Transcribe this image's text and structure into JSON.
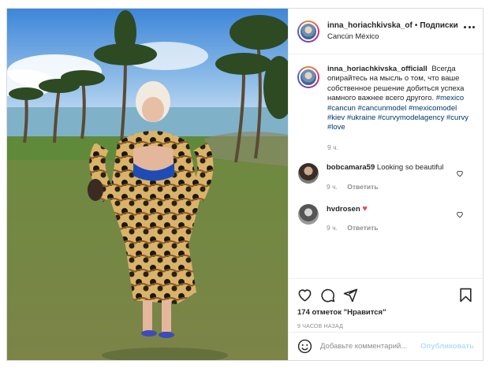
{
  "post": {
    "header": {
      "username": "inna_horiachkivska_of",
      "separator": "•",
      "follow_label": "Подписки",
      "location": "Cancún México",
      "more_icon": "more-horizontal-icon"
    },
    "caption": {
      "username": "inna_horiachkivska_officiall",
      "text": "Всегда опирайтесь на мысль о том, что ваше собственное решение добиться успеха намного важнее всего другого.",
      "hashtags": "#mexico #cancun #cancunmodel #mexicomodel #kiev #ukraine #curvymodelagency #curvy #love",
      "time": "9 ч."
    },
    "comments": [
      {
        "username": "bobcamara59",
        "text": "Looking so beautiful",
        "time": "9 ч.",
        "reply": "Ответить"
      },
      {
        "username": "hvdrosen",
        "text": "♥",
        "time": "9 ч.",
        "reply": "Ответить"
      }
    ],
    "actions": {
      "icons": [
        "heart-icon",
        "comment-icon",
        "share-icon",
        "bookmark-icon"
      ],
      "likes": "174 отметок \"Нравится\"",
      "timestamp": "9 ЧАСОВ НАЗАД"
    },
    "add_comment": {
      "placeholder": "Добавьте комментарий...",
      "publish_label": "Опубликовать"
    },
    "colors": {
      "link": "#00376b",
      "heart": "#ed4956",
      "publish_disabled": "#b2dffc",
      "meta": "#8e8e8e",
      "border": "#dbdbdb"
    }
  }
}
